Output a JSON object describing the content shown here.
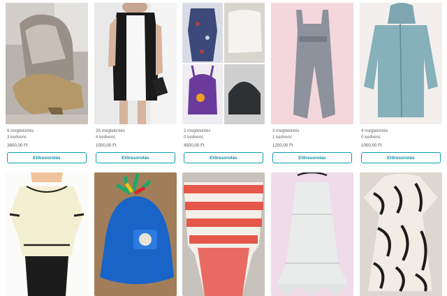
{
  "items": [
    {
      "views": "6 megtekintés",
      "favorites": "3 kedvenc",
      "price": "3600,00 Ft",
      "button": "Előresorolás",
      "image": "fur-lined-boots-photo"
    },
    {
      "views": "26 megtekintés",
      "favorites": "4 kedvenc",
      "price": "1500,00 Ft",
      "button": "Előresorolás",
      "image": "black-white-dress-photo"
    },
    {
      "views": "2 megtekintés",
      "favorites": "0 kedvenc",
      "price": "4500,00 Ft",
      "button": "Előresorolás",
      "image": "clothes-collage-photo"
    },
    {
      "views": "3 megtekintés",
      "favorites": "1 kedvenc",
      "price": "1200,00 Ft",
      "button": "Előresorolás",
      "image": "grey-jumpsuit-photo"
    },
    {
      "views": "4 megtekintés",
      "favorites": "0 kedvenc",
      "price": "1000,00 Ft",
      "button": "Előresorolás",
      "image": "blue-hoodie-photo"
    }
  ],
  "bottom_row": [
    {
      "image": "cold-shoulder-blouse-photo"
    },
    {
      "image": "blue-kids-hat-photo"
    },
    {
      "image": "striped-knit-top-photo"
    },
    {
      "image": "white-crochet-dress-photo"
    },
    {
      "image": "zebra-print-dress-photo"
    }
  ],
  "colors": {
    "accent": "#0a9db0"
  }
}
